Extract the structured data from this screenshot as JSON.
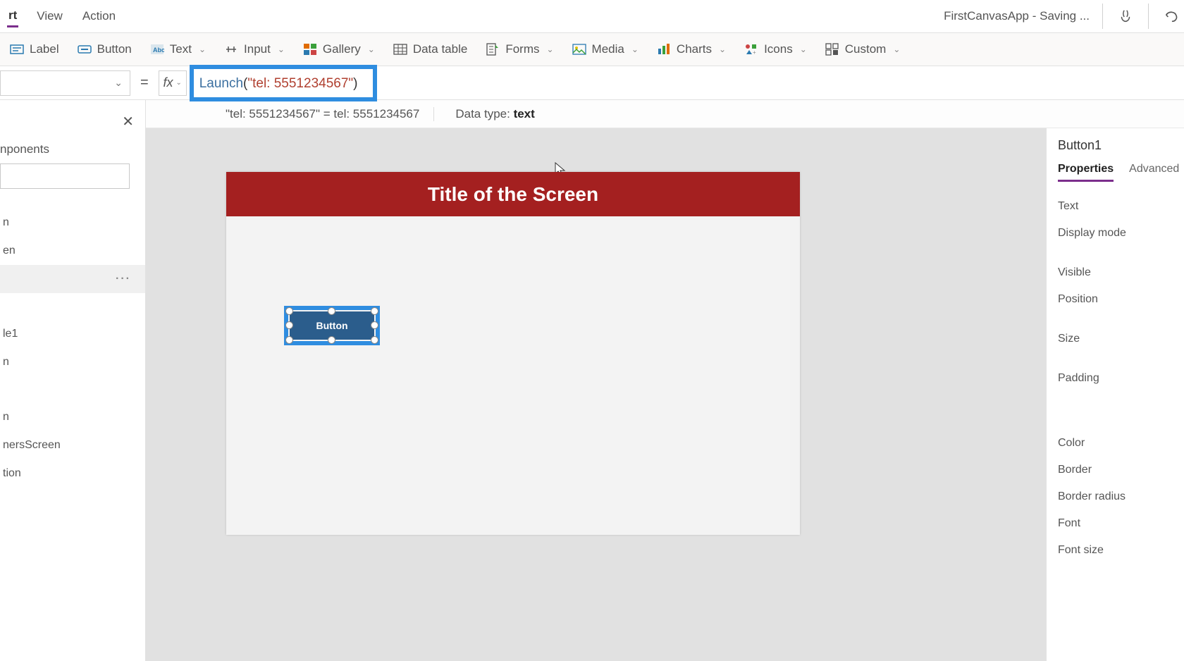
{
  "menubar": {
    "items": [
      "rt",
      "View",
      "Action"
    ],
    "app_title": "FirstCanvasApp - Saving ..."
  },
  "ribbon": {
    "label_btn": "Label",
    "button_btn": "Button",
    "text_btn": "Text",
    "input_btn": "Input",
    "gallery_btn": "Gallery",
    "datatable_btn": "Data table",
    "forms_btn": "Forms",
    "media_btn": "Media",
    "charts_btn": "Charts",
    "icons_btn": "Icons",
    "custom_btn": "Custom"
  },
  "formula": {
    "equals": "=",
    "fx": "fx",
    "fn_name": "Launch",
    "open_paren": "(",
    "string_literal": "\"tel: 5551234567\"",
    "close_paren": ")"
  },
  "eval": {
    "expression": "\"tel: 5551234567\"  =  tel: 5551234567",
    "datatype_label": "Data type: ",
    "datatype_value": "text"
  },
  "left": {
    "section": "nponents",
    "close": "✕",
    "tree": [
      "n",
      "en",
      "",
      "le1",
      "n",
      "n",
      "nersScreen",
      "tion"
    ]
  },
  "canvas": {
    "title": "Title of the Screen",
    "button_text": "Button"
  },
  "right": {
    "object": "Button1",
    "tabs": {
      "properties": "Properties",
      "advanced": "Advanced"
    },
    "props": [
      "Text",
      "Display mode",
      "Visible",
      "Position",
      "Size",
      "Padding",
      "Color",
      "Border",
      "Border radius",
      "Font",
      "Font size"
    ]
  }
}
